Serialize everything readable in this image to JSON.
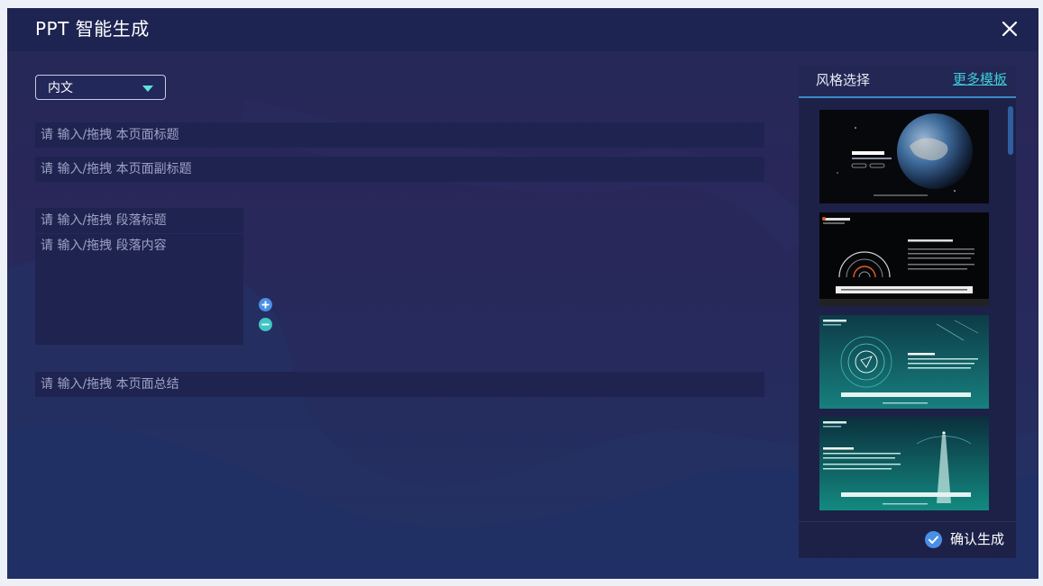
{
  "window": {
    "title": "PPT 智能生成"
  },
  "form": {
    "type_select": {
      "value": "内文"
    },
    "page_title_placeholder": "请 输入/拖拽 本页面标题",
    "page_subtitle_placeholder": "请 输入/拖拽 本页面副标题",
    "paragraph_title_placeholder": "请 输入/拖拽 段落标题",
    "paragraph_content_placeholder": "请 输入/拖拽 段落内容",
    "page_summary_placeholder": "请 输入/拖拽 本页面总结"
  },
  "style_panel": {
    "title": "风格选择",
    "more_link": "更多模板",
    "confirm_label": "确认生成",
    "accent_color": "#3ecbd6"
  }
}
